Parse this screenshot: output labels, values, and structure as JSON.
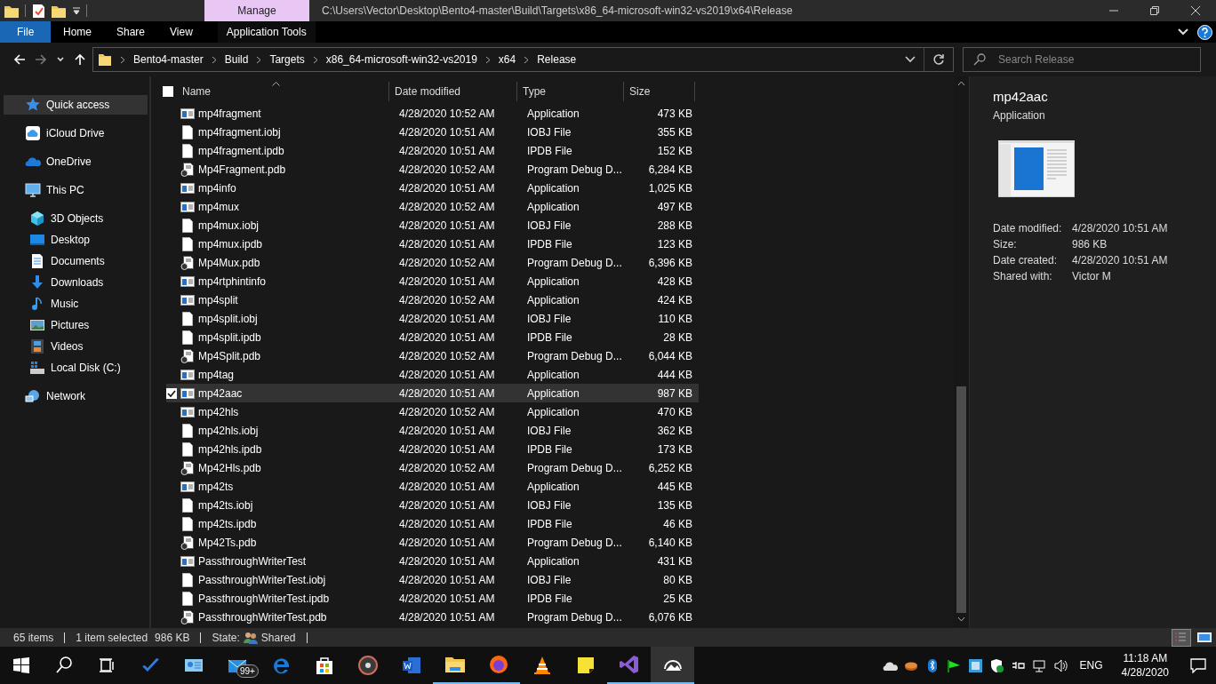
{
  "window": {
    "title": "C:\\Users\\Vector\\Desktop\\Bento4-master\\Build\\Targets\\x86_64-microsoft-win32-vs2019\\x64\\Release",
    "context_tab": "Manage"
  },
  "ribbon": {
    "tabs": [
      {
        "label": "File",
        "kind": "menu"
      },
      {
        "label": "Home",
        "kind": "tab"
      },
      {
        "label": "Share",
        "kind": "tab"
      },
      {
        "label": "View",
        "kind": "tab"
      },
      {
        "label": "Application Tools",
        "kind": "context"
      }
    ]
  },
  "address_bar": {
    "crumbs": [
      "Bento4-master",
      "Build",
      "Targets",
      "x86_64-microsoft-win32-vs2019",
      "x64",
      "Release"
    ]
  },
  "search": {
    "placeholder": "Search Release"
  },
  "sidebar": {
    "items": [
      {
        "label": "Quick access",
        "selected": true
      },
      {
        "label": "iCloud Drive",
        "selected": false
      },
      {
        "label": "OneDrive",
        "selected": false
      },
      {
        "label": "This PC",
        "selected": false,
        "children": [
          {
            "label": "3D Objects",
            "selected": false
          },
          {
            "label": "Desktop",
            "selected": false
          },
          {
            "label": "Documents",
            "selected": false
          },
          {
            "label": "Downloads",
            "selected": false
          },
          {
            "label": "Music",
            "selected": false
          },
          {
            "label": "Pictures",
            "selected": false
          },
          {
            "label": "Videos",
            "selected": false
          },
          {
            "label": "Local Disk (C:)",
            "selected": false
          }
        ]
      },
      {
        "label": "Network",
        "selected": false
      }
    ]
  },
  "file_list": {
    "all_checked": false,
    "columns": [
      {
        "label": "Name",
        "sorted": true
      },
      {
        "label": "Date modified",
        "sorted": false
      },
      {
        "label": "Type",
        "sorted": false
      },
      {
        "label": "Size",
        "sorted": false
      }
    ],
    "rows": [
      {
        "kind": "app",
        "name": "mp4fragment",
        "date": "4/28/2020 10:52 AM",
        "type": "Application",
        "size": "473 KB",
        "selected": false
      },
      {
        "kind": "file",
        "name": "mp4fragment.iobj",
        "date": "4/28/2020 10:51 AM",
        "type": "IOBJ File",
        "size": "355 KB",
        "selected": false
      },
      {
        "kind": "file",
        "name": "mp4fragment.ipdb",
        "date": "4/28/2020 10:51 AM",
        "type": "IPDB File",
        "size": "152 KB",
        "selected": false
      },
      {
        "kind": "pdb",
        "name": "Mp4Fragment.pdb",
        "date": "4/28/2020 10:52 AM",
        "type": "Program Debug D...",
        "size": "6,284 KB",
        "selected": false
      },
      {
        "kind": "app",
        "name": "mp4info",
        "date": "4/28/2020 10:51 AM",
        "type": "Application",
        "size": "1,025 KB",
        "selected": false
      },
      {
        "kind": "app",
        "name": "mp4mux",
        "date": "4/28/2020 10:52 AM",
        "type": "Application",
        "size": "497 KB",
        "selected": false
      },
      {
        "kind": "file",
        "name": "mp4mux.iobj",
        "date": "4/28/2020 10:51 AM",
        "type": "IOBJ File",
        "size": "288 KB",
        "selected": false
      },
      {
        "kind": "file",
        "name": "mp4mux.ipdb",
        "date": "4/28/2020 10:51 AM",
        "type": "IPDB File",
        "size": "123 KB",
        "selected": false
      },
      {
        "kind": "pdb",
        "name": "Mp4Mux.pdb",
        "date": "4/28/2020 10:52 AM",
        "type": "Program Debug D...",
        "size": "6,396 KB",
        "selected": false
      },
      {
        "kind": "app",
        "name": "mp4rtphintinfo",
        "date": "4/28/2020 10:51 AM",
        "type": "Application",
        "size": "428 KB",
        "selected": false
      },
      {
        "kind": "app",
        "name": "mp4split",
        "date": "4/28/2020 10:52 AM",
        "type": "Application",
        "size": "424 KB",
        "selected": false
      },
      {
        "kind": "file",
        "name": "mp4split.iobj",
        "date": "4/28/2020 10:51 AM",
        "type": "IOBJ File",
        "size": "110 KB",
        "selected": false
      },
      {
        "kind": "file",
        "name": "mp4split.ipdb",
        "date": "4/28/2020 10:51 AM",
        "type": "IPDB File",
        "size": "28 KB",
        "selected": false
      },
      {
        "kind": "pdb",
        "name": "Mp4Split.pdb",
        "date": "4/28/2020 10:52 AM",
        "type": "Program Debug D...",
        "size": "6,044 KB",
        "selected": false
      },
      {
        "kind": "app",
        "name": "mp4tag",
        "date": "4/28/2020 10:51 AM",
        "type": "Application",
        "size": "444 KB",
        "selected": false
      },
      {
        "kind": "app",
        "name": "mp42aac",
        "date": "4/28/2020 10:51 AM",
        "type": "Application",
        "size": "987 KB",
        "selected": true
      },
      {
        "kind": "app",
        "name": "mp42hls",
        "date": "4/28/2020 10:52 AM",
        "type": "Application",
        "size": "470 KB",
        "selected": false
      },
      {
        "kind": "file",
        "name": "mp42hls.iobj",
        "date": "4/28/2020 10:51 AM",
        "type": "IOBJ File",
        "size": "362 KB",
        "selected": false
      },
      {
        "kind": "file",
        "name": "mp42hls.ipdb",
        "date": "4/28/2020 10:51 AM",
        "type": "IPDB File",
        "size": "173 KB",
        "selected": false
      },
      {
        "kind": "pdb",
        "name": "Mp42Hls.pdb",
        "date": "4/28/2020 10:52 AM",
        "type": "Program Debug D...",
        "size": "6,252 KB",
        "selected": false
      },
      {
        "kind": "app",
        "name": "mp42ts",
        "date": "4/28/2020 10:51 AM",
        "type": "Application",
        "size": "445 KB",
        "selected": false
      },
      {
        "kind": "file",
        "name": "mp42ts.iobj",
        "date": "4/28/2020 10:51 AM",
        "type": "IOBJ File",
        "size": "135 KB",
        "selected": false
      },
      {
        "kind": "file",
        "name": "mp42ts.ipdb",
        "date": "4/28/2020 10:51 AM",
        "type": "IPDB File",
        "size": "46 KB",
        "selected": false
      },
      {
        "kind": "pdb",
        "name": "Mp42Ts.pdb",
        "date": "4/28/2020 10:51 AM",
        "type": "Program Debug D...",
        "size": "6,140 KB",
        "selected": false
      },
      {
        "kind": "app",
        "name": "PassthroughWriterTest",
        "date": "4/28/2020 10:51 AM",
        "type": "Application",
        "size": "431 KB",
        "selected": false
      },
      {
        "kind": "file",
        "name": "PassthroughWriterTest.iobj",
        "date": "4/28/2020 10:51 AM",
        "type": "IOBJ File",
        "size": "80 KB",
        "selected": false
      },
      {
        "kind": "file",
        "name": "PassthroughWriterTest.ipdb",
        "date": "4/28/2020 10:51 AM",
        "type": "IPDB File",
        "size": "25 KB",
        "selected": false
      },
      {
        "kind": "pdb",
        "name": "PassthroughWriterTest.pdb",
        "date": "4/28/2020 10:51 AM",
        "type": "Program Debug D...",
        "size": "6,076 KB",
        "selected": false
      }
    ]
  },
  "preview": {
    "name": "mp42aac",
    "type": "Application",
    "properties": [
      {
        "label": "Date modified:",
        "value": "4/28/2020 10:51 AM"
      },
      {
        "label": "Size:",
        "value": "986 KB"
      },
      {
        "label": "Date created:",
        "value": "4/28/2020 10:51 AM"
      },
      {
        "label": "Shared with:",
        "value": "Victor M"
      }
    ]
  },
  "status_bar": {
    "item_count": "65 items",
    "selection": "1 item selected",
    "selection_size": "986 KB",
    "state_label": "State:",
    "state": "Shared",
    "views": [
      {
        "kind": "details",
        "selected": true
      },
      {
        "kind": "large",
        "selected": false
      }
    ]
  },
  "taskbar": {
    "apps": [
      {
        "running": false,
        "selected": false
      },
      {
        "running": false,
        "selected": false
      },
      {
        "running": false,
        "selected": false,
        "badge": "99+"
      },
      {
        "running": false,
        "selected": false
      },
      {
        "running": false,
        "selected": false
      },
      {
        "running": false,
        "selected": false
      },
      {
        "running": false,
        "selected": false
      },
      {
        "running": true,
        "selected": false
      },
      {
        "running": true,
        "selected": false
      },
      {
        "running": false,
        "selected": false
      },
      {
        "running": false,
        "selected": false
      },
      {
        "running": true,
        "selected": false
      },
      {
        "running": true,
        "selected": true
      }
    ],
    "language": "ENG",
    "time": "11:18 AM",
    "date": "4/28/2020"
  }
}
